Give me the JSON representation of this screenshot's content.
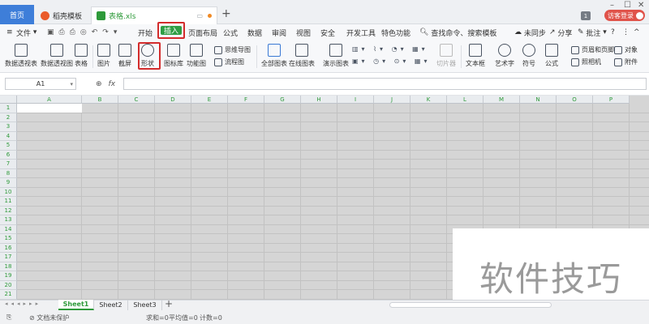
{
  "tabbar": {
    "home": "首页",
    "template": "稻壳模板",
    "document": "表格.xls",
    "count_badge": "1",
    "login": "访客登录"
  },
  "menu": {
    "file": "文件",
    "tabs": [
      "开始",
      "插入",
      "页面布局",
      "公式",
      "数据",
      "审阅",
      "视图",
      "安全",
      "开发工具",
      "特色功能"
    ],
    "search": "查找命令、搜索模板",
    "sync": "未同步",
    "share": "分享",
    "annotate": "批注"
  },
  "ribbon": {
    "pivot_table": "数据透视表",
    "pivot_chart": "数据透视图",
    "table": "表格",
    "picture": "图片",
    "screenshot": "截屏",
    "shape": "形状",
    "icon_lib": "图标库",
    "function_chart": "功能图",
    "mindmap": "思维导图",
    "flowchart": "流程图",
    "all_charts": "全部图表",
    "online_chart": "在线图表",
    "demo_chart": "演示图表",
    "slicer": "切片器",
    "textbox": "文本框",
    "wordart": "艺术字",
    "symbol": "符号",
    "formula": "公式",
    "header_footer": "页眉和页脚",
    "object": "对象",
    "camera": "照相机",
    "attachment": "附件"
  },
  "formula_bar": {
    "cell_ref": "A1",
    "fx": "fx",
    "value": ""
  },
  "grid": {
    "columns": [
      "A",
      "B",
      "C",
      "D",
      "E",
      "F",
      "G",
      "H",
      "I",
      "J",
      "K",
      "L",
      "M",
      "N",
      "O",
      "P"
    ],
    "rows": [
      "1",
      "2",
      "3",
      "4",
      "5",
      "6",
      "7",
      "8",
      "9",
      "10",
      "11",
      "12",
      "13",
      "14",
      "15",
      "16",
      "17",
      "18",
      "19",
      "20",
      "21"
    ]
  },
  "sheets": [
    "Sheet1",
    "Sheet2",
    "Sheet3"
  ],
  "status": {
    "protect": "文档未保护",
    "sum": "求和=0",
    "avg": "平均值=0",
    "count": "计数=0"
  },
  "watermark": "软件技巧",
  "colors": {
    "accent_green": "#2e9a3a",
    "highlight_red": "#d32c2c",
    "home_blue": "#3e7ed9"
  }
}
